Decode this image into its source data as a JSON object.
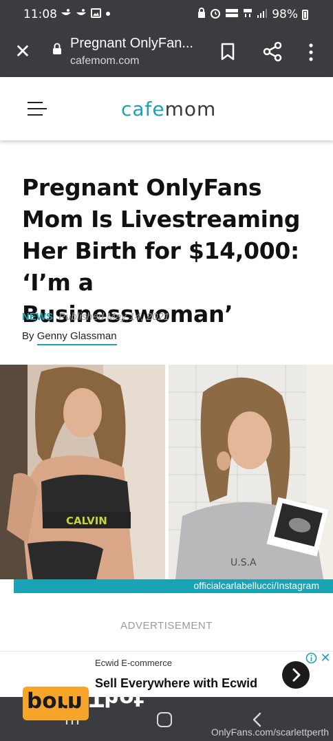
{
  "status_bar": {
    "time": "11:08",
    "battery": "98%",
    "left_icons": [
      "notification-icon",
      "notification-icon",
      "image-icon",
      "dot-icon"
    ],
    "right_icons": [
      "lock-icon",
      "alarm-icon",
      "volte-icon",
      "4g-icon",
      "signal-icon",
      "battery-icon"
    ]
  },
  "browser": {
    "page_title": "Pregnant OnlyFan...",
    "domain": "cafemom.com"
  },
  "site": {
    "logo_part1": "cafe",
    "logo_part2": "mom"
  },
  "article": {
    "headline": "Pregnant OnlyFans Mom Is Livestreaming Her Birth for $14,000: ‘I’m a Businesswoman’",
    "category": "NEWS",
    "published": "Published May 14, 2021",
    "by_prefix": "By",
    "author": "Genny Glassman",
    "image_credit": "officialcarlabellucci/Instagram",
    "left_photo_text": "CALVIN",
    "right_photo_text": "U.S.A"
  },
  "advertisement": {
    "label": "ADVERTISEMENT",
    "brand": "Ecwid E-commerce",
    "title": "Sell Everywhere with Ecwid"
  },
  "watermark": {
    "box_text": "porn",
    "text": "Thot",
    "corner": "OnlyFans.com/scarlettperth"
  },
  "colors": {
    "accent": "#1aa3b4",
    "chrome": "#3a3c40",
    "watermark_orange": "#f7a42a"
  }
}
